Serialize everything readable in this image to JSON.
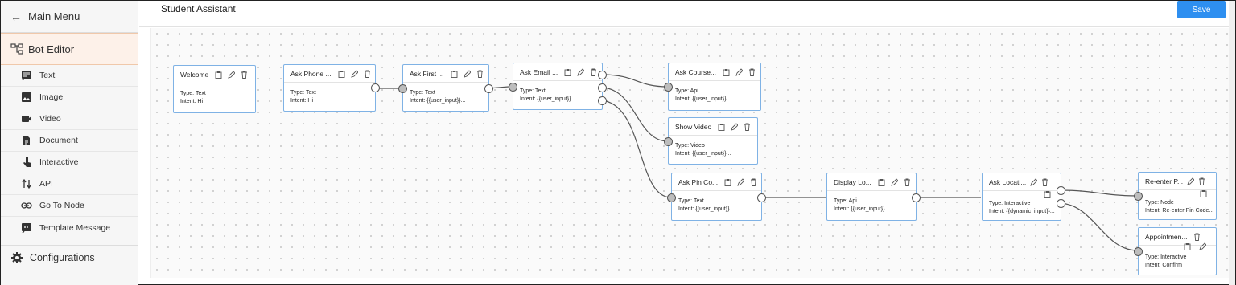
{
  "sidebar": {
    "main_menu": "Main Menu",
    "bot_editor": "Bot Editor",
    "items": [
      {
        "label": "Text",
        "icon": "text-icon"
      },
      {
        "label": "Image",
        "icon": "image-icon"
      },
      {
        "label": "Video",
        "icon": "video-icon"
      },
      {
        "label": "Document",
        "icon": "document-icon"
      },
      {
        "label": "Interactive",
        "icon": "interactive-icon"
      },
      {
        "label": "API",
        "icon": "api-icon"
      },
      {
        "label": "Go To Node",
        "icon": "link-icon"
      },
      {
        "label": "Template Message",
        "icon": "template-icon"
      }
    ],
    "configurations": "Configurations"
  },
  "header": {
    "title": "Student Assistant",
    "save_label": "Save",
    "accent": "#2e8ff0"
  },
  "nodes": [
    {
      "title": "Welcome",
      "type": "Type: Text",
      "intent": "Intent: Hi"
    },
    {
      "title": "Ask Phone ...",
      "type": "Type: Text",
      "intent": "Intent: Hi"
    },
    {
      "title": "Ask First ...",
      "type": "Type: Text",
      "intent": "Intent: {{user_input}}..."
    },
    {
      "title": "Ask Email ...",
      "type": "Type: Text",
      "intent": "Intent: {{user_input}}..."
    },
    {
      "title": "Ask Course...",
      "type": "Type: Api",
      "intent": "Intent: {{user_input}}..."
    },
    {
      "title": "Show Video",
      "type": "Type: Video",
      "intent": "Intent: {{user_input}}..."
    },
    {
      "title": "Ask Pin Co...",
      "type": "Type: Text",
      "intent": "Intent: {{user_input}}..."
    },
    {
      "title": "Display Lo...",
      "type": "Type: Api",
      "intent": "Intent: {{user_input}}..."
    },
    {
      "title": "Ask Locati...",
      "type": "Type: Interactive",
      "intent": "Intent: {{dynamic_input}}..."
    },
    {
      "title": "Re-enter P...",
      "type": "Type: Node",
      "intent": "Intent: Re-enter Pin Code..."
    },
    {
      "title": "Appointmen...",
      "type": "Type: Interactive",
      "intent": "Intent: Confirm"
    }
  ]
}
